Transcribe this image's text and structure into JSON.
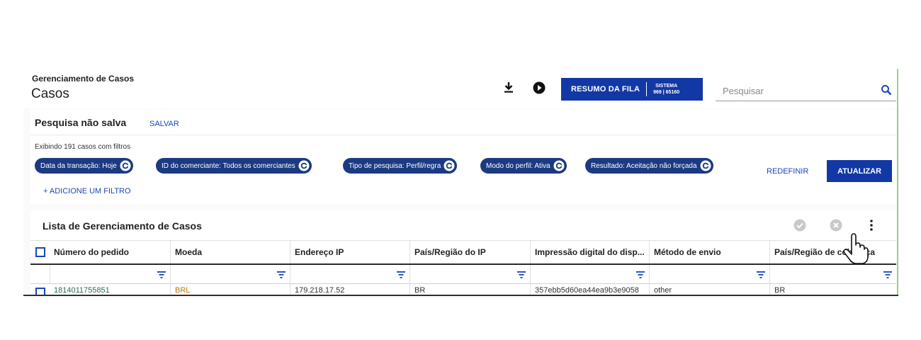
{
  "header": {
    "breadcrumb": "Gerenciamento de Casos",
    "title": "Casos",
    "queue_button": {
      "label": "RESUMO DA FILA",
      "system_label": "SISTEMA",
      "system_value": "969 | 65160"
    },
    "search": {
      "placeholder": "Pesquisar"
    }
  },
  "filters": {
    "unsaved_label": "Pesquisa não salva",
    "save_label": "SALVAR",
    "showing_text": "Exibindo 191 casos com filtros",
    "chips": [
      "Data da transação: Hoje",
      "ID do comerciante: Todos os comerciantes",
      "Tipo de pesquisa: Perfil/regra",
      "Modo do perfil: Ativa",
      "Resultado: Aceitação não forçada"
    ],
    "reset_label": "REDEFINIR",
    "update_label": "ATUALIZAR",
    "add_filter_label": "+ ADICIONE UM FILTRO"
  },
  "list": {
    "title": "Lista de Gerenciamento de Casos",
    "columns": [
      "Número do pedido",
      "Moeda",
      "Endereço IP",
      "País/Região do IP",
      "Impressão digital do disp...",
      "Método de envio",
      "País/Região de cobrança"
    ],
    "rows": [
      [
        "1814011755851",
        "BRL",
        "179.218.17.52",
        "BR",
        "357ebb5d60ea44ea9b3e9058",
        "other",
        "BR"
      ]
    ]
  },
  "colors": {
    "primary": "#1238a6",
    "chip": "#1b3a82",
    "link": "#1a47b8",
    "row_link": "#2d6b4f",
    "currency": "#b87a00"
  },
  "icons": [
    "download-icon",
    "play-icon",
    "search-icon",
    "refresh-icon",
    "check-circle-icon",
    "cancel-circle-icon",
    "more-vertical-icon",
    "filter-icon",
    "cursor-icon"
  ]
}
